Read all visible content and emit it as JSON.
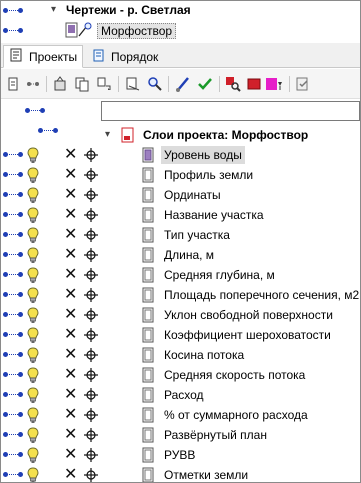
{
  "tree": {
    "parent_label": "Чертежи - р. Светлая",
    "child_label": "Морфоствор"
  },
  "tabs": [
    {
      "label": "Проекты",
      "active": true
    },
    {
      "label": "Порядок",
      "active": false
    }
  ],
  "toolbar_icons": [
    "link-layer-icon",
    "unlink-layer-icon",
    "properties-icon",
    "copy-icon",
    "move-icon",
    "cut-icon",
    "find-icon",
    "brush-icon",
    "check-icon",
    "zoom-red-icon",
    "red-square-icon",
    "color-icon",
    "settings-icon"
  ],
  "filter": {
    "value": ""
  },
  "project": {
    "label": "Слои проекта: Морфоствор"
  },
  "layers": [
    {
      "label": "Уровень воды",
      "selected": true
    },
    {
      "label": "Профиль земли",
      "selected": false
    },
    {
      "label": "Ординаты",
      "selected": false
    },
    {
      "label": "Название участка",
      "selected": false
    },
    {
      "label": "Тип участка",
      "selected": false
    },
    {
      "label": "Длина, м",
      "selected": false
    },
    {
      "label": "Средняя глубина, м",
      "selected": false
    },
    {
      "label": "Площадь поперечного сечения, м2",
      "selected": false
    },
    {
      "label": "Уклон свободной поверхности",
      "selected": false
    },
    {
      "label": "Коэффициент шероховатости",
      "selected": false
    },
    {
      "label": "Косина потока",
      "selected": false
    },
    {
      "label": "Средняя скорость потока",
      "selected": false
    },
    {
      "label": "Расход",
      "selected": false
    },
    {
      "label": "% от суммарного расхода",
      "selected": false
    },
    {
      "label": "Развёрнутый план",
      "selected": false
    },
    {
      "label": "РУВВ",
      "selected": false
    },
    {
      "label": "Отметки земли",
      "selected": false
    }
  ],
  "colors": {
    "link": "#1f3fb5",
    "bulb": "#f4e04d",
    "selected_bg": "#dcdcdc"
  }
}
